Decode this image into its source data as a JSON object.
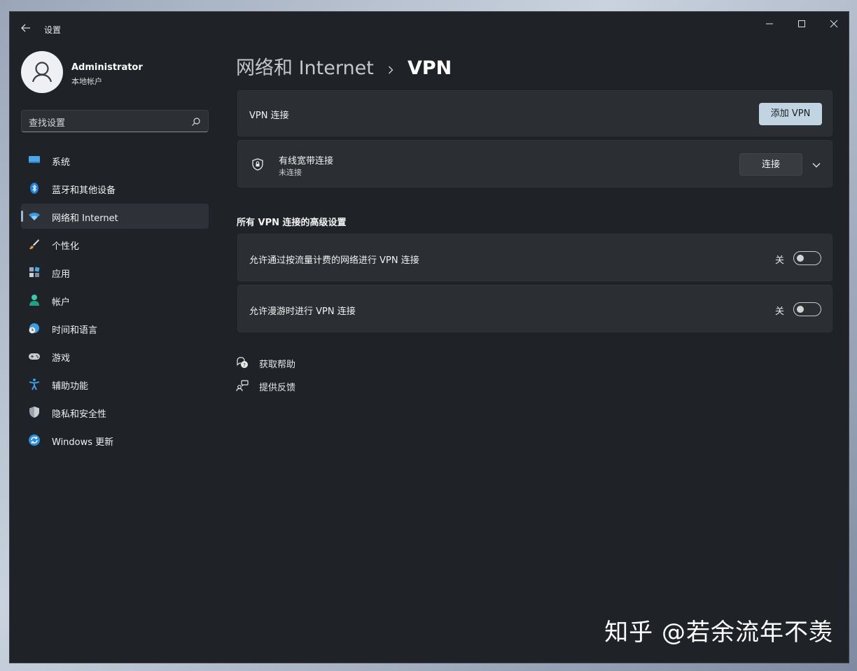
{
  "window": {
    "title": "设置",
    "controls": {
      "minimize": "minimize-icon",
      "maximize": "maximize-icon",
      "close": "close-icon"
    }
  },
  "profile": {
    "name": "Administrator",
    "account_type": "本地帐户"
  },
  "search": {
    "placeholder": "查找设置"
  },
  "sidebar": {
    "items": [
      {
        "label": "系统",
        "icon": "monitor-icon",
        "selected": false
      },
      {
        "label": "蓝牙和其他设备",
        "icon": "bluetooth-icon",
        "selected": false
      },
      {
        "label": "网络和 Internet",
        "icon": "wifi-icon",
        "selected": true
      },
      {
        "label": "个性化",
        "icon": "brush-icon",
        "selected": false
      },
      {
        "label": "应用",
        "icon": "apps-icon",
        "selected": false
      },
      {
        "label": "帐户",
        "icon": "person-icon",
        "selected": false
      },
      {
        "label": "时间和语言",
        "icon": "globe-clock-icon",
        "selected": false
      },
      {
        "label": "游戏",
        "icon": "gamepad-icon",
        "selected": false
      },
      {
        "label": "辅助功能",
        "icon": "accessibility-icon",
        "selected": false
      },
      {
        "label": "隐私和安全性",
        "icon": "shield-icon",
        "selected": false
      },
      {
        "label": "Windows 更新",
        "icon": "update-icon",
        "selected": false
      }
    ]
  },
  "breadcrumb": {
    "parent": "网络和 Internet",
    "current": "VPN"
  },
  "vpn": {
    "header_label": "VPN 连接",
    "add_button": "添加 VPN",
    "connection": {
      "name": "有线宽带连接",
      "status": "未连接",
      "connect_button": "连接"
    }
  },
  "advanced": {
    "title": "所有 VPN 连接的高级设置",
    "settings": [
      {
        "label": "允许通过按流量计费的网络进行 VPN 连接",
        "state_label": "关"
      },
      {
        "label": "允许漫游时进行 VPN 连接",
        "state_label": "关"
      }
    ]
  },
  "links": {
    "help": "获取帮助",
    "feedback": "提供反馈"
  },
  "watermark": "知乎 @若余流年不羡",
  "colors": {
    "background": "#1f2227",
    "card": "#2b2e33",
    "accent_button": "#c0d5e1",
    "selected_nav": "#2e3137"
  }
}
